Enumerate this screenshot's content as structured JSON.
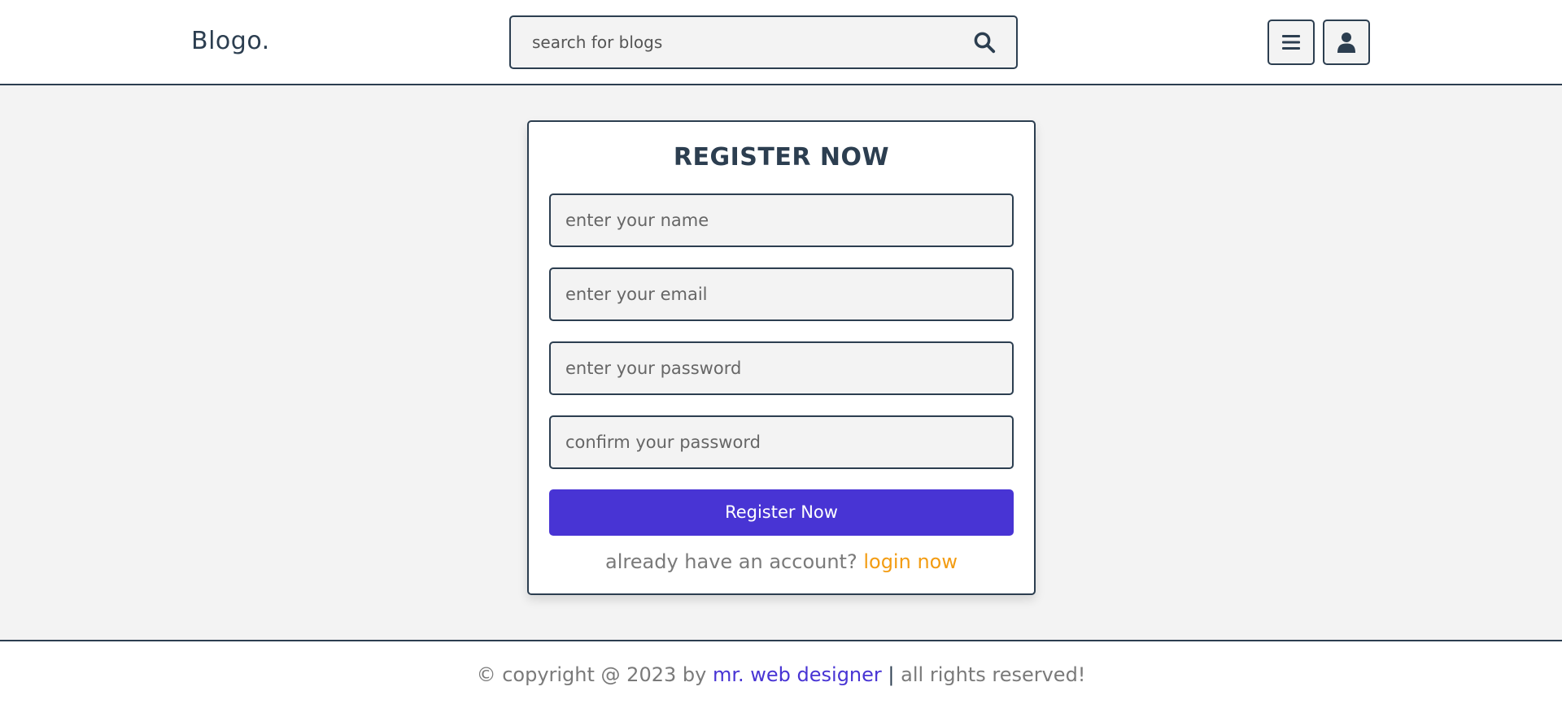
{
  "header": {
    "logo": "Blogo.",
    "search": {
      "placeholder": "search for blogs",
      "value": ""
    },
    "icons": [
      "menu-icon",
      "user-icon",
      "search-icon"
    ]
  },
  "register_form": {
    "title": "REGISTER NOW",
    "fields": [
      {
        "placeholder": "enter your name",
        "value": ""
      },
      {
        "placeholder": "enter your email",
        "value": ""
      },
      {
        "placeholder": "enter your password",
        "value": ""
      },
      {
        "placeholder": "confirm your password",
        "value": ""
      }
    ],
    "submit_label": "Register Now",
    "login_prompt": "already have an account?",
    "login_link": "login now"
  },
  "footer": {
    "prefix": "© copyright @ 2023 by",
    "author_link": "mr. web designer",
    "separator": "|",
    "suffix": "all rights reserved!"
  },
  "colors": {
    "primary": "#2c3e50",
    "accent_button": "#4834d4",
    "link_orange": "#f39c12",
    "background": "#f3f3f3"
  }
}
